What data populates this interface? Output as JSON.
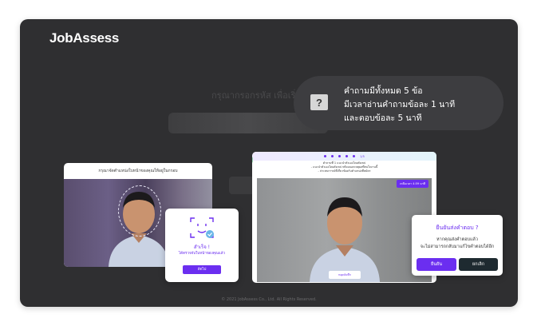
{
  "brand": {
    "logo": "JobAssess"
  },
  "background": {
    "placeholder": "กรุณากรอกรหัส เพื่อเริ่ม"
  },
  "info": {
    "icon": "question-icon",
    "icon_glyph": "?",
    "line1": "คำถามมีทั้งหมด 5 ข้อ",
    "line2": "มีเวลาอ่านคำถามข้อละ 1 นาที",
    "line3": "และตอบข้อละ 5 นาที"
  },
  "card1": {
    "header": "กรุณาจัดตำแหน่งใบหน้าของคุณให้อยู่ในกรอบ",
    "success_title": "สำเร็จ !",
    "success_subtitle": "ได้ตรวจจับใบหน้าของคุณแล้ว",
    "next_button": "ถัดไป"
  },
  "card2": {
    "step_label": "1/5",
    "question_title": "คำถามที่ 1 แนะนำตัวเองโดยสังเขป",
    "question_line1": "- แนะนำตัวเองโดยสังเขป พร้อมบอกเหตุผลที่สนใจงานนี้",
    "question_line2": "- ประสบการณ์ที่เกี่ยวข้องกับตำแหน่งที่สมัคร",
    "timer": "เหลือเวลา 4:59 นาที",
    "stop_button": "หยุดบันทึก"
  },
  "confirm": {
    "title": "ยืนยันส่งคำตอบ ?",
    "line1": "หากคุณส่งคำตอบแล้ว",
    "line2": "จะไม่สามารถกลับมาแก้ไขคำตอบได้อีก",
    "confirm_button": "ยืนยัน",
    "cancel_button": "ยกเลิก"
  },
  "footer": {
    "copyright": "© 2021 JobAssess Co., Ltd. All Rights Reserved."
  },
  "colors": {
    "accent": "#6b2ef0",
    "dark": "#1e2a30",
    "frame": "#2f2f31"
  }
}
